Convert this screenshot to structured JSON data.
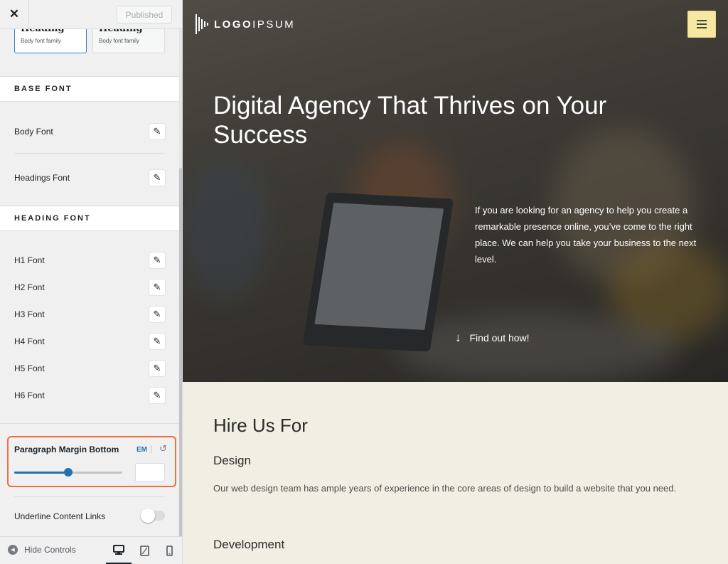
{
  "customizer": {
    "publish_label": "Published",
    "presets": [
      {
        "heading": "Heading",
        "sub": "Body font family"
      },
      {
        "heading": "Heading",
        "sub": "Body font family"
      }
    ],
    "base_font": {
      "title": "BASE FONT",
      "items": [
        "Body Font",
        "Headings Font"
      ]
    },
    "heading_font": {
      "title": "HEADING FONT",
      "items": [
        "H1 Font",
        "H2 Font",
        "H3 Font",
        "H4 Font",
        "H5 Font",
        "H6 Font"
      ]
    },
    "paragraph_margin": {
      "label": "Paragraph Margin Bottom",
      "unit": "EM",
      "value": "",
      "slider_fraction": 0.5
    },
    "underline_links": {
      "label": "Underline Content Links",
      "enabled": false
    },
    "footer": {
      "hide_controls_label": "Hide Controls"
    }
  },
  "preview": {
    "logo": {
      "bold": "LOGO",
      "light": "IPSUM"
    },
    "hero": {
      "title": "Digital Agency That Thrives on Your Success",
      "description": "If you are looking for an agency to help you create a remarkable presence online, you’ve come to the right place. We can help you take your business to the next level.",
      "cta": "Find out how!"
    },
    "services": {
      "title": "Hire Us For",
      "design_heading": "Design",
      "design_text": "Our web design team has ample years of experience in the core areas of design to build a website that you need.",
      "development_heading": "Development"
    }
  },
  "colors": {
    "accent": "#2271b1",
    "highlight_border": "#f26d3d",
    "menu_button": "#f6e7a2",
    "content_bg": "#f1efe3"
  }
}
